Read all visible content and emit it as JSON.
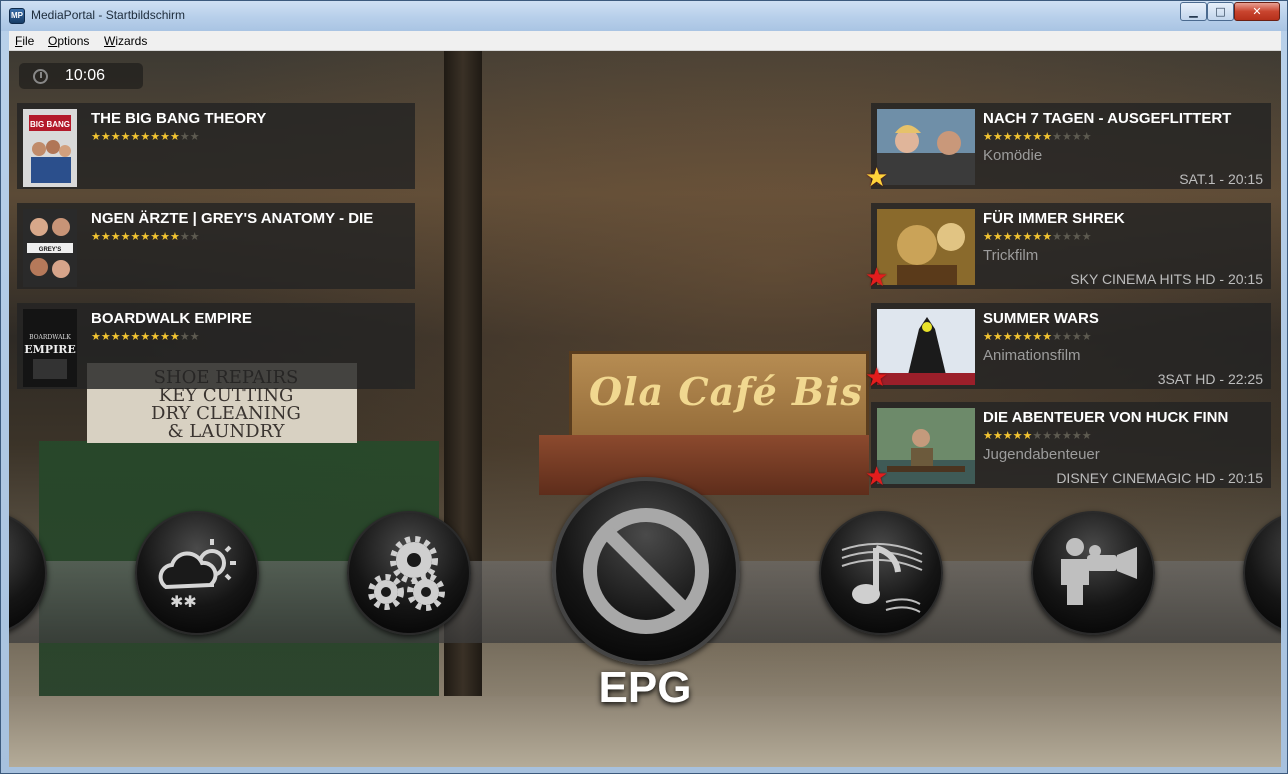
{
  "window": {
    "title": "MediaPortal - Startbildschirm",
    "controls": {
      "minimize": "▁",
      "maximize": "□",
      "close": "✕"
    }
  },
  "menubar": {
    "items": [
      "File",
      "Options",
      "Wizards"
    ]
  },
  "clock": {
    "time": "10:06"
  },
  "background": {
    "cafe_sign": "Ola Café Bis",
    "shop_sign": "SHOE REPAIRS\nKEY CUTTING\nDRY CLEANING\n& LAUNDRY"
  },
  "series": [
    {
      "title": "THE BIG BANG THEORY",
      "rating": 9,
      "max": 11,
      "poster_text": "THE BIG BANG THEORY"
    },
    {
      "title": "NGEN ÄRZTE | GREY'S ANATOMY - DIE",
      "rating": 9,
      "max": 11,
      "poster_text": "GREY'S ANATOMY"
    },
    {
      "title": "BOARDWALK EMPIRE",
      "rating": 9,
      "max": 11,
      "poster_text": "BOARDWALK EMPIRE"
    }
  ],
  "tv": [
    {
      "title": "NACH 7 TAGEN - AUSGEFLITTERT",
      "rating": 7,
      "max": 11,
      "genre": "Komödie",
      "channel": "SAT.1 - 20:15",
      "badge": "gold"
    },
    {
      "title": "FÜR IMMER SHREK",
      "rating": 7,
      "max": 11,
      "genre": "Trickfilm",
      "channel": "SKY CINEMA HITS HD - 20:15",
      "badge": "red"
    },
    {
      "title": "SUMMER WARS",
      "rating": 7,
      "max": 11,
      "genre": "Animationsfilm",
      "channel": "3SAT HD - 22:25",
      "badge": "red"
    },
    {
      "title": "DIE ABENTEUER VON HUCK FINN",
      "rating": 5,
      "max": 11,
      "genre": "Jugendabenteuer",
      "channel": "DISNEY CINEMAGIC HD - 20:15",
      "badge": "red"
    }
  ],
  "menu": {
    "selected_label": "EPG"
  },
  "colors": {
    "star_on": "#f2c431",
    "star_off": "#5d5a50",
    "badge_red": "#e21d1d",
    "badge_gold": "#ffd33a"
  }
}
